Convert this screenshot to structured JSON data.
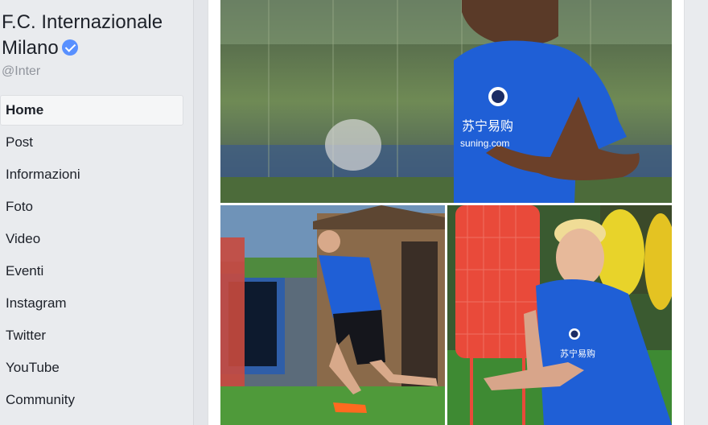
{
  "page": {
    "name": "F.C. Internazionale Milano",
    "handle": "@Inter"
  },
  "nav": {
    "items": [
      {
        "label": "Home",
        "active": true
      },
      {
        "label": "Post"
      },
      {
        "label": "Informazioni"
      },
      {
        "label": "Foto"
      },
      {
        "label": "Video"
      },
      {
        "label": "Eventi"
      },
      {
        "label": "Instagram"
      },
      {
        "label": "Twitter"
      },
      {
        "label": "YouTube"
      },
      {
        "label": "Community"
      }
    ]
  },
  "colors": {
    "background": "#e9ebee",
    "verified": "#5890ff",
    "jersey": "#1f5fd6"
  }
}
